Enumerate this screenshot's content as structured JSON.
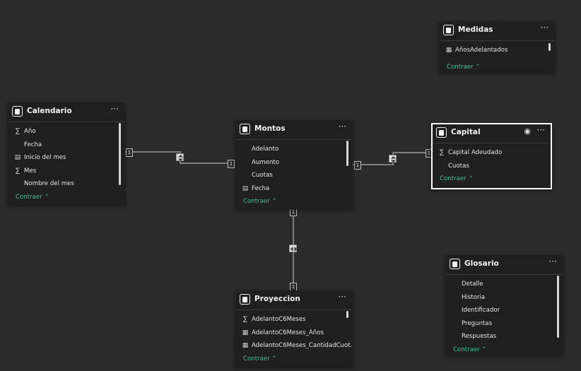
{
  "tables": {
    "medidas": {
      "title": "Medidas",
      "fields": [
        {
          "label": "AñosAdelantados",
          "icon": "calculator-icon"
        }
      ],
      "collapse_label": "Contraer"
    },
    "calendario": {
      "title": "Calendario",
      "fields": [
        {
          "label": "Año",
          "icon": "sigma-icon"
        },
        {
          "label": "Fecha",
          "icon": ""
        },
        {
          "label": "Inicio del mes",
          "icon": "calendar-icon"
        },
        {
          "label": "Mes",
          "icon": "sigma-icon"
        },
        {
          "label": "Nombre del mes",
          "icon": ""
        }
      ],
      "collapse_label": "Contraer"
    },
    "montos": {
      "title": "Montos",
      "fields": [
        {
          "label": "Adelanto",
          "icon": ""
        },
        {
          "label": "Aumento",
          "icon": ""
        },
        {
          "label": "Cuotas",
          "icon": ""
        },
        {
          "label": "Fecha",
          "icon": "calendar-icon"
        }
      ],
      "collapse_label": "Contraer"
    },
    "capital": {
      "title": "Capital",
      "fields": [
        {
          "label": "Capital Adeudado",
          "icon": "sigma-icon"
        },
        {
          "label": "Cuotas",
          "icon": ""
        }
      ],
      "collapse_label": "Contraer"
    },
    "glosario": {
      "title": "Glosario",
      "fields": [
        {
          "label": "Detalle",
          "icon": ""
        },
        {
          "label": "Historia",
          "icon": ""
        },
        {
          "label": "Identificador",
          "icon": ""
        },
        {
          "label": "Preguntas",
          "icon": ""
        },
        {
          "label": "Respuestas",
          "icon": ""
        }
      ],
      "collapse_label": "Contraer"
    },
    "proyeccion": {
      "title": "Proyeccion",
      "fields": [
        {
          "label": "AdelantoC6Meses",
          "icon": "sigma-icon"
        },
        {
          "label": "AdelantoC6Meses_Años",
          "icon": "calculated-column-icon"
        },
        {
          "label": "AdelantoC6Meses_CantidadCuot…",
          "icon": "calculated-column-icon"
        }
      ],
      "collapse_label": "Contraer"
    }
  },
  "relationships": {
    "calendario_montos": {
      "from_card": "1",
      "to_card": "1"
    },
    "montos_capital": {
      "from_card": "1",
      "to_card": "1"
    },
    "montos_proyeccion": {
      "from_card": "1",
      "to_card": "1"
    }
  },
  "colors": {
    "canvas": "#2b2b2b",
    "card": "#1f1f1f",
    "accent_link": "#3cc49a",
    "line": "#9a9a9a"
  },
  "icons": {
    "table": "table-icon",
    "more": "more-options-icon",
    "eye": "eye-icon",
    "collapse": "chevron-up-icon"
  },
  "more_glyph": "···",
  "eye_glyph": "◉",
  "collapse_glyph": "⌃"
}
